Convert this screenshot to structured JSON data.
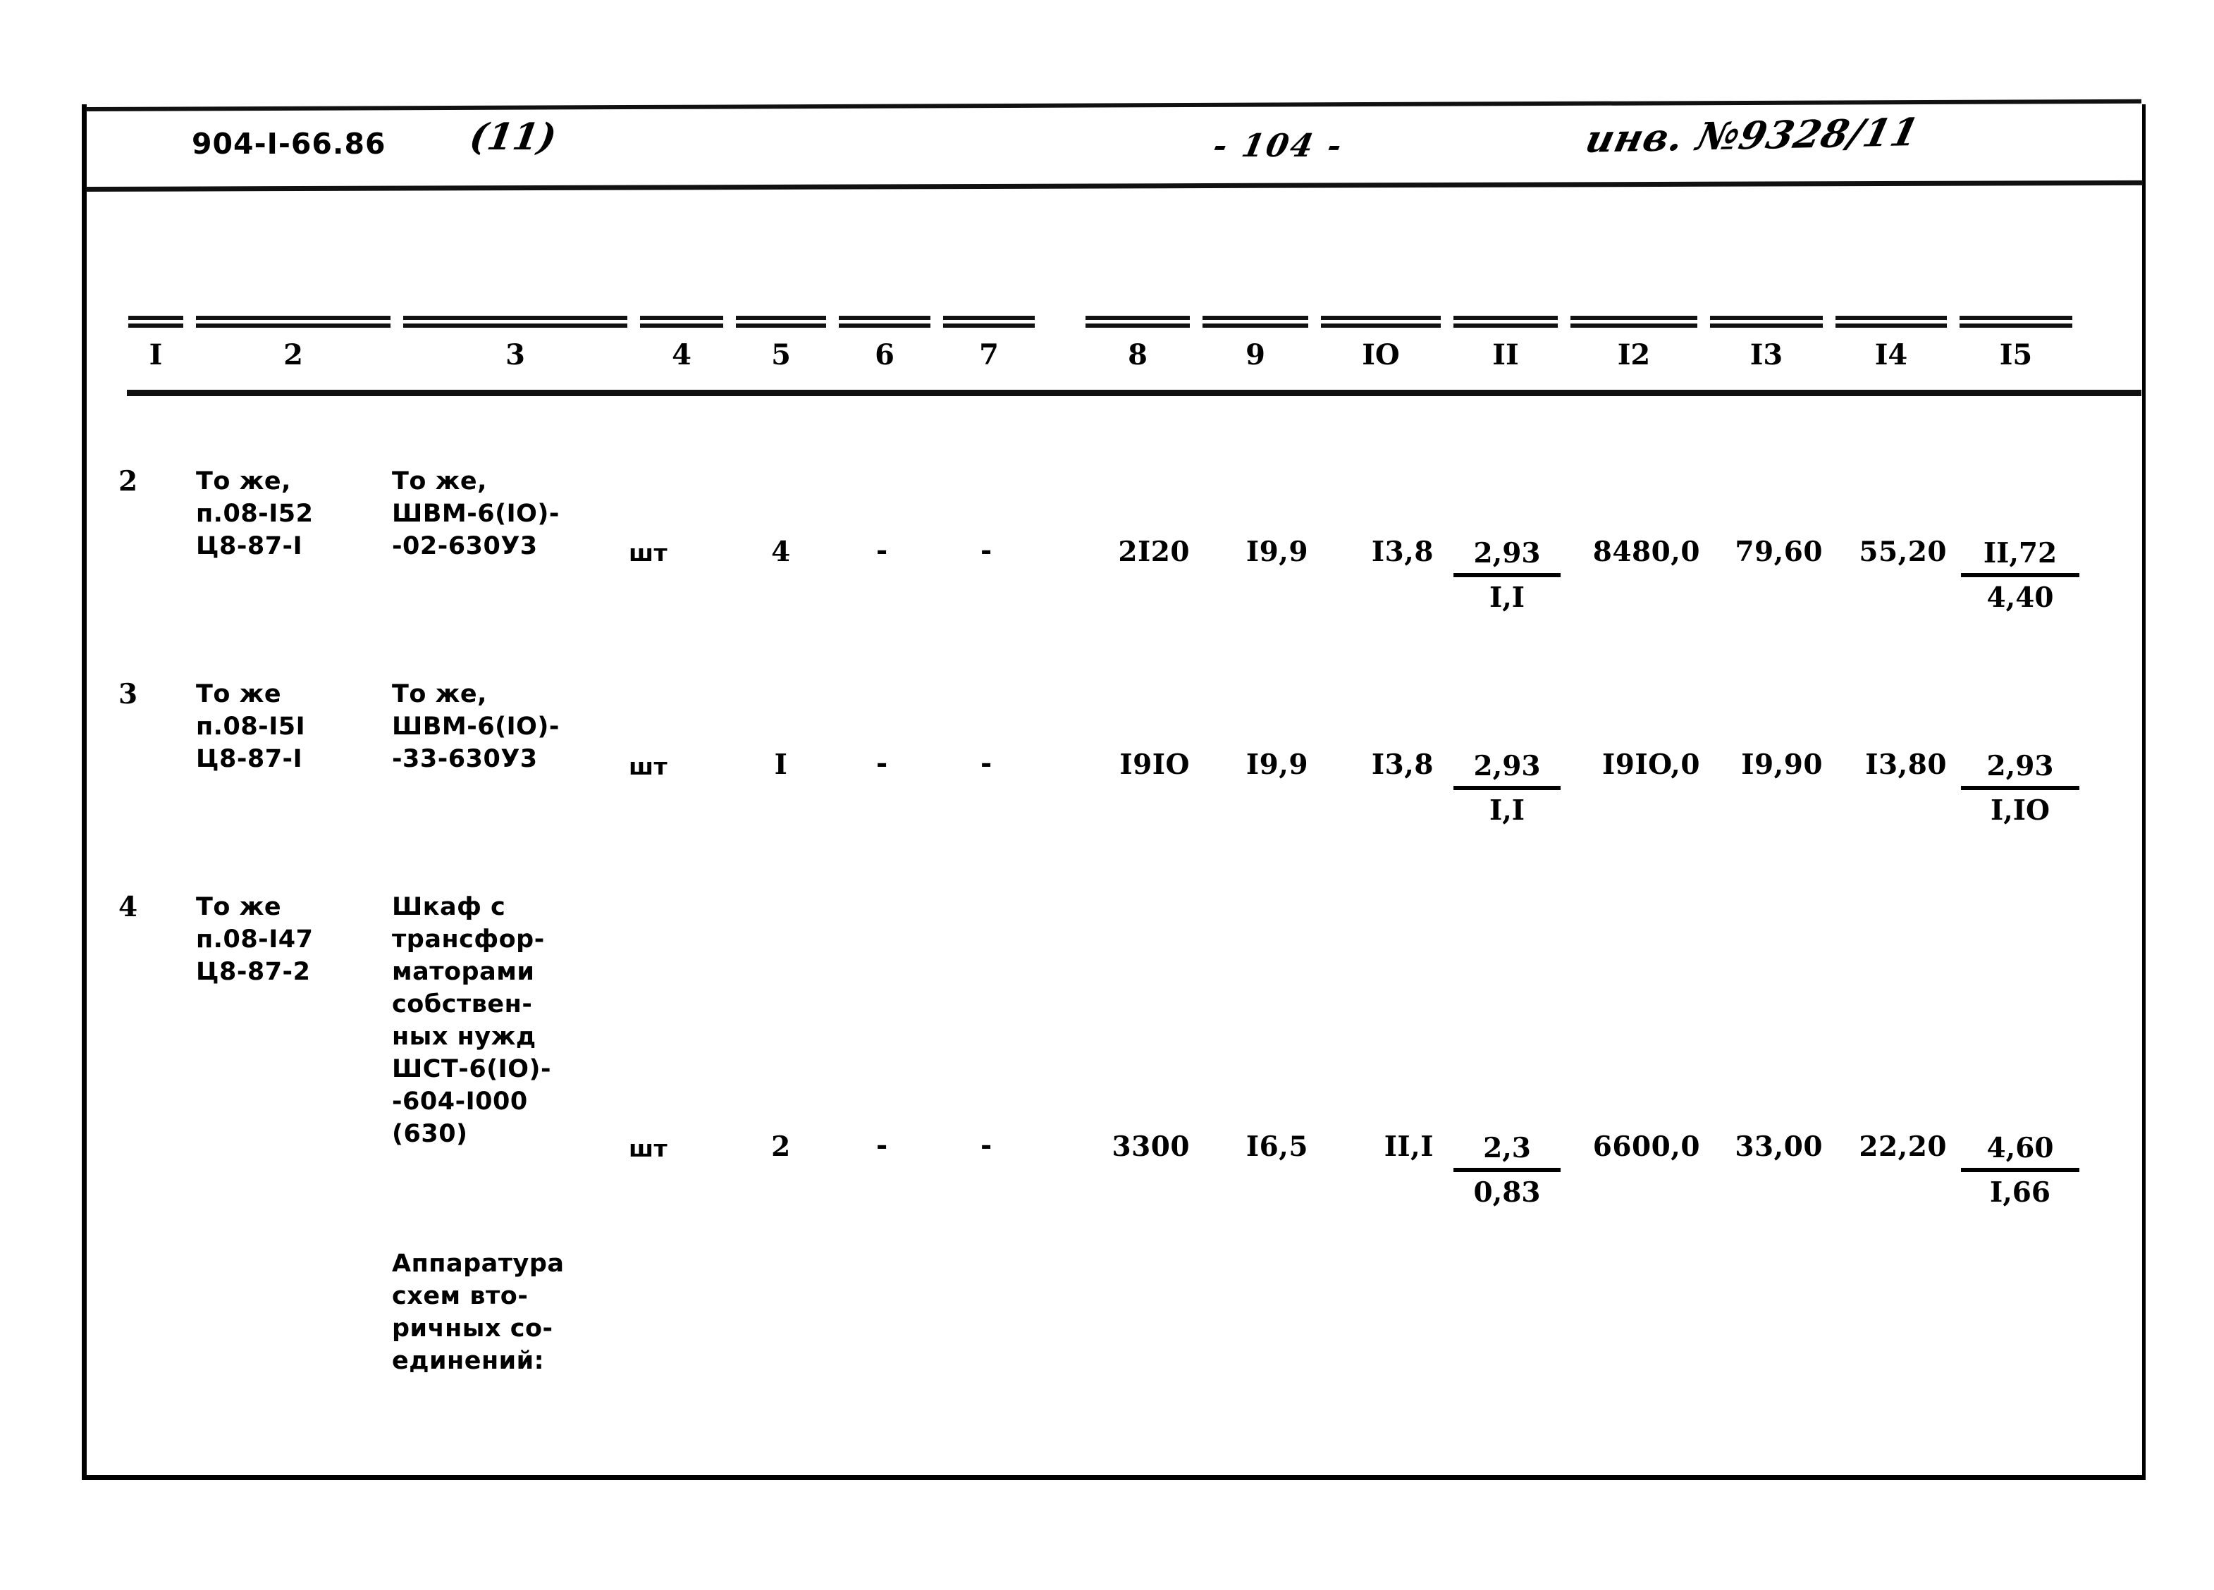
{
  "header": {
    "doc_code": "904-I-66.86",
    "sheet_mark": "(11)",
    "page_number": "- 104 -",
    "inventory_number": "инв. №9328/11"
  },
  "table": {
    "column_numbers": [
      "I",
      "2",
      "3",
      "4",
      "5",
      "6",
      "7",
      "8",
      "9",
      "IO",
      "II",
      "I2",
      "I3",
      "I4",
      "I5"
    ],
    "rows": [
      {
        "c1": "2",
        "c2": "То же,\nп.08-I52\nЦ8-87-I",
        "c3": "То же,\nШВМ-6(IO)-\n-02-630У3",
        "c4": "шт",
        "c5": "4",
        "c6": "-",
        "c7": "-",
        "c8": "2I20",
        "c9": "I9,9",
        "c10": "I3,8",
        "c11_top": "2,93",
        "c11_bot": "I,I",
        "c12": "8480,0",
        "c13": "79,60",
        "c14": "55,20",
        "c15_top": "II,72",
        "c15_bot": "4,40"
      },
      {
        "c1": "3",
        "c2": "То же\nп.08-I5I\nЦ8-87-I",
        "c3": "То же,\nШВМ-6(IO)-\n-33-630У3",
        "c4": "шт",
        "c5": "I",
        "c6": "-",
        "c7": "-",
        "c8": "I9IO",
        "c9": "I9,9",
        "c10": "I3,8",
        "c11_top": "2,93",
        "c11_bot": "I,I",
        "c12": "I9IO,0",
        "c13": "I9,90",
        "c14": "I3,80",
        "c15_top": "2,93",
        "c15_bot": "I,IO"
      },
      {
        "c1": "4",
        "c2": "То же\nп.08-I47\nЦ8-87-2",
        "c3": "Шкаф с\nтрансфор-\nматорами\nсобствен-\nных нужд\nШСТ-6(IO)-\n-604-I000\n(630)",
        "c4": "шт",
        "c5": "2",
        "c6": "-",
        "c7": "-",
        "c8": "3300",
        "c9": "I6,5",
        "c10": "II,I",
        "c11_top": "2,3",
        "c11_bot": "0,83",
        "c12": "6600,0",
        "c13": "33,00",
        "c14": "22,20",
        "c15_top": "4,60",
        "c15_bot": "I,66"
      }
    ],
    "footer_note": "Аппаратура\nсхем вто-\nричных со-\nединений:"
  }
}
